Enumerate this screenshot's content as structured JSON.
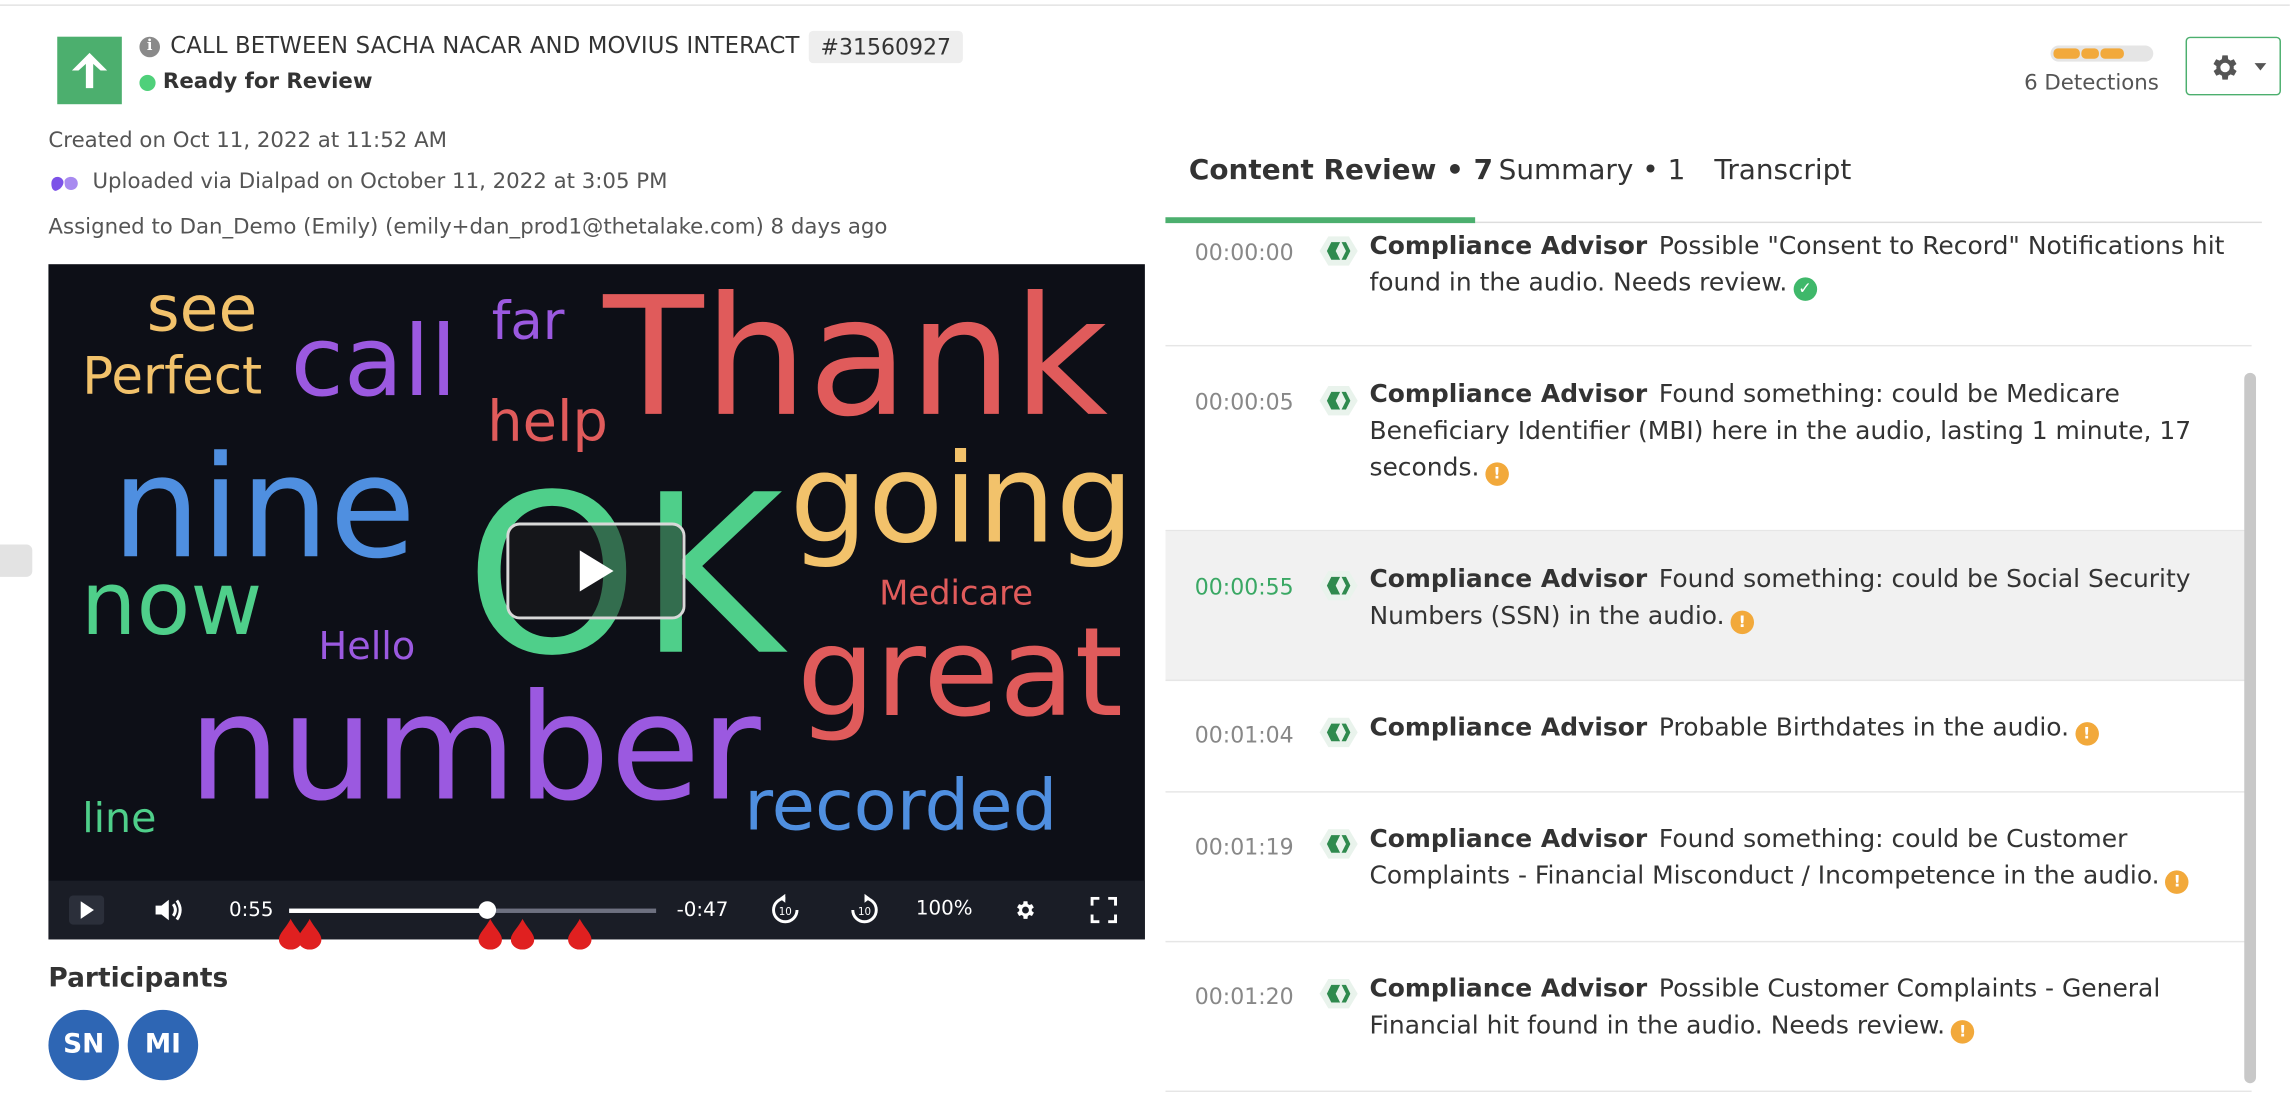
{
  "header": {
    "title": "CALL BETWEEN SACHA NACAR AND MOVIUS INTERACT",
    "id_badge": "#31560927",
    "status": "Ready for Review"
  },
  "meta": {
    "created": "Created on Oct 11, 2022 at 11:52 AM",
    "uploaded": "Uploaded via Dialpad on October 11, 2022 at 3:05 PM",
    "assigned": "Assigned to Dan_Demo (Emily) (emily+dan_prod1@thetalake.com) 8 days ago"
  },
  "wordcloud": [
    {
      "text": "see",
      "color": "#f2c26b"
    },
    {
      "text": "Perfect",
      "color": "#f2c26b"
    },
    {
      "text": "call",
      "color": "#9b59e0"
    },
    {
      "text": "far",
      "color": "#9b59e0"
    },
    {
      "text": "Thank",
      "color": "#e05b5b"
    },
    {
      "text": "help",
      "color": "#e05b5b"
    },
    {
      "text": "nine",
      "color": "#4f8fe0"
    },
    {
      "text": "OK",
      "color": "#4fcf8a"
    },
    {
      "text": "going",
      "color": "#f2c26b"
    },
    {
      "text": "now",
      "color": "#4fcf8a"
    },
    {
      "text": "Medicare",
      "color": "#e05b5b"
    },
    {
      "text": "Hello",
      "color": "#9b59e0"
    },
    {
      "text": "great",
      "color": "#e05b5b"
    },
    {
      "text": "number",
      "color": "#9b59e0"
    },
    {
      "text": "line",
      "color": "#4fcf8a"
    },
    {
      "text": "recorded",
      "color": "#4f8fe0"
    }
  ],
  "player": {
    "elapsed": "0:55",
    "remaining": "-0:47",
    "speed": "100%",
    "progress": 0.54
  },
  "participants": {
    "label": "Participants",
    "people": [
      "SN",
      "MI"
    ]
  },
  "detections": {
    "label": "6 Detections",
    "color": "#f2a93b"
  },
  "tabs": [
    {
      "label": "Content Review • 7"
    },
    {
      "label": "Summary • 1"
    },
    {
      "label": "Transcript"
    }
  ],
  "review_items": [
    {
      "time": "00:00:00",
      "source": "Compliance Advisor",
      "text": "Possible \"Consent to Record\" Notifications hit found in the audio. Needs review.",
      "status": "ok"
    },
    {
      "time": "00:00:05",
      "source": "Compliance Advisor",
      "text": "Found something: could be Medicare Beneficiary Identifier (MBI)  here in the audio, lasting 1 minute, 17 seconds.",
      "status": "warn"
    },
    {
      "time": "00:00:55",
      "source": "Compliance Advisor",
      "text": "Found something: could be Social Security Numbers (SSN) in the audio.",
      "status": "warn"
    },
    {
      "time": "00:01:04",
      "source": "Compliance Advisor",
      "text": "Probable Birthdates in the audio.",
      "status": "warn"
    },
    {
      "time": "00:01:19",
      "source": "Compliance Advisor",
      "text": "Found something: could be Customer Complaints - Financial Misconduct / Incompetence in the audio.",
      "status": "warn"
    },
    {
      "time": "00:01:20",
      "source": "Compliance Advisor",
      "text": "Possible Customer Complaints - General Financial hit found in the audio. Needs review.",
      "status": "warn"
    }
  ]
}
